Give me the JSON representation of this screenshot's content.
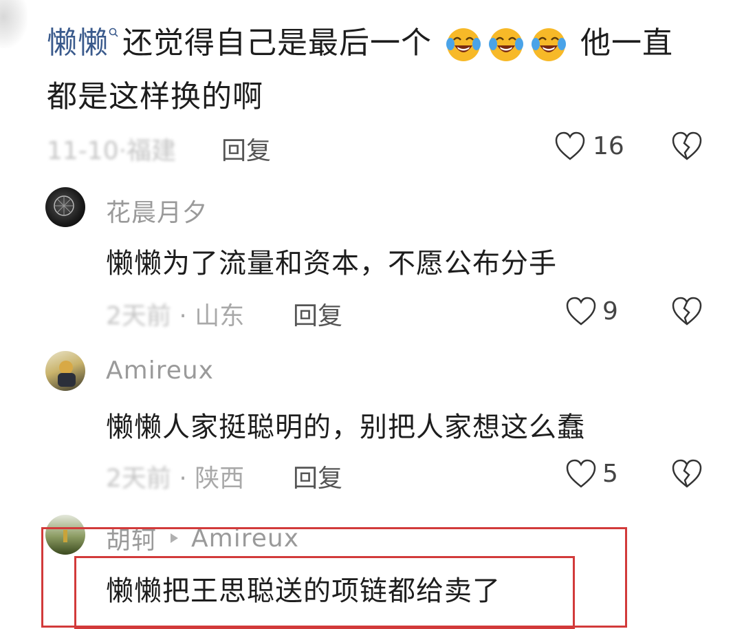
{
  "comment": {
    "author": "懒懒",
    "text_line1": "还觉得自己是最后一个",
    "emoji_names": [
      "laughing-crying-emoji",
      "laughing-crying-emoji",
      "laughing-crying-emoji"
    ],
    "text_line1_end": "他一直",
    "text_line2": "都是这样换的啊",
    "date": "11-10·福建",
    "reply_label": "回复",
    "like_count": "16"
  },
  "replies": [
    {
      "author": "花晨月夕",
      "text": "懒懒为了流量和资本，不愿公布分手",
      "time": "2天前",
      "location": "· 山东",
      "reply_label": "回复",
      "like_count": "9"
    },
    {
      "author": "Amireux",
      "text": "懒懒人家挺聪明的，别把人家想这么蠢",
      "time": "2天前",
      "location": "· 陕西",
      "reply_label": "回复",
      "like_count": "5"
    },
    {
      "author": "胡轲",
      "reply_to": "Amireux",
      "text": "懒懒把王思聪送的项链都给卖了"
    }
  ],
  "colors": {
    "highlight": "#d23a3a",
    "mention": "#3a5a8c",
    "emoji_face": "#f7b928",
    "emoji_tears": "#4aa3e8"
  }
}
